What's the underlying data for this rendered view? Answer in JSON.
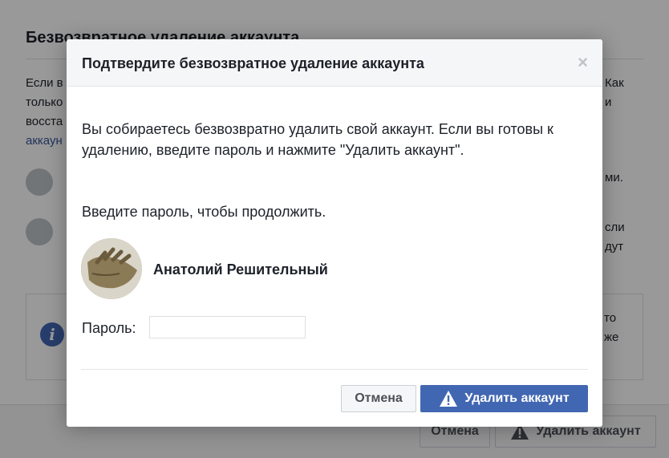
{
  "background": {
    "title": "Безвозвратное удаление аккаунта",
    "text_left_1": "Если в",
    "text_left_2": "только",
    "text_left_3": "восста",
    "text_left_4_link": "аккаун",
    "text_right_1": "Как",
    "text_right_2": "и",
    "text_right_3": "ми.",
    "text_right_4": "сли",
    "text_right_5": "дут",
    "text_right_6": "то",
    "text_right_7": "же",
    "cancel_label": "Отмена",
    "delete_label": "Удалить аккаунт"
  },
  "dialog": {
    "title": "Подтвердите безвозвратное удаление аккаунта",
    "close_glyph": "×",
    "body_text": "Вы собираетесь безвозвратно удалить свой аккаунт. Если вы готовы к удалению, введите пароль и нажмите \"Удалить аккаунт\".",
    "prompt": "Введите пароль, чтобы продолжить.",
    "user_name": "Анатолий Решительный",
    "password_label": "Пароль:",
    "password_value": "",
    "cancel_label": "Отмена",
    "delete_label": "Удалить аккаунт",
    "delete_icon": "warning-triangle-icon"
  },
  "colors": {
    "primary": "#4267b2",
    "overlay": "rgba(0,0,0,0.4)",
    "header_bg": "#f5f6f7"
  }
}
